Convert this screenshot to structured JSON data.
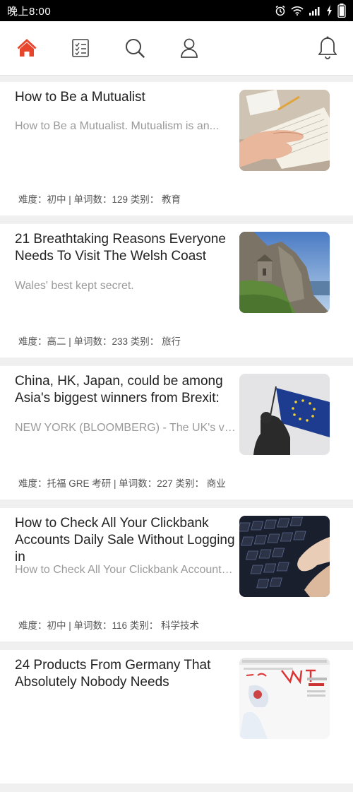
{
  "status_bar": {
    "time": "晚上8:00",
    "icons": [
      "alarm-icon",
      "wifi-icon",
      "signal-icon",
      "charging-icon",
      "battery-icon"
    ]
  },
  "nav": {
    "items": [
      {
        "name": "home",
        "icon": "home-icon",
        "active": true
      },
      {
        "name": "tasks",
        "icon": "checklist-icon",
        "active": false
      },
      {
        "name": "search",
        "icon": "search-icon",
        "active": false
      },
      {
        "name": "profile",
        "icon": "person-icon",
        "active": false
      },
      {
        "name": "notifications",
        "icon": "bell-icon",
        "active": false
      }
    ],
    "accent_color": "#e8452d"
  },
  "articles": [
    {
      "title": "How to Be a Mutualist",
      "summary": "How to Be a Mutualist. Mutualism is an...",
      "meta": "难度：初中 | 单词数：129 类别： 教育",
      "thumbnail": "hand-on-book-photo"
    },
    {
      "title": "21 Breathtaking Reasons Everyone Needs To Visit The Welsh Coast",
      "summary": "Wales' best kept secret.",
      "meta": "难度：高二 | 单词数：233 类别： 旅行",
      "thumbnail": "coastal-cliff-chapel-photo"
    },
    {
      "title": "China, HK, Japan, could be among Asia's biggest winners from Brexit:",
      "summary": "NEW YORK (BLOOMBERG) - The UK's vote to...",
      "meta": "难度：托福 GRE 考研 | 单词数：227 类别： 商业",
      "thumbnail": "eu-flag-statue-photo"
    },
    {
      "title": "How to Check All Your Clickbank Accounts Daily Sale Without Logging in",
      "summary": "How to Check All Your Clickbank Accounts Dai...",
      "meta": "难度：初中 | 单词数：116 类别： 科学技术",
      "thumbnail": "keyboard-typing-photo"
    },
    {
      "title": "24 Products From Germany That Absolutely Nobody Needs",
      "summary": "",
      "meta": "",
      "thumbnail": "product-webpage-photo"
    }
  ]
}
